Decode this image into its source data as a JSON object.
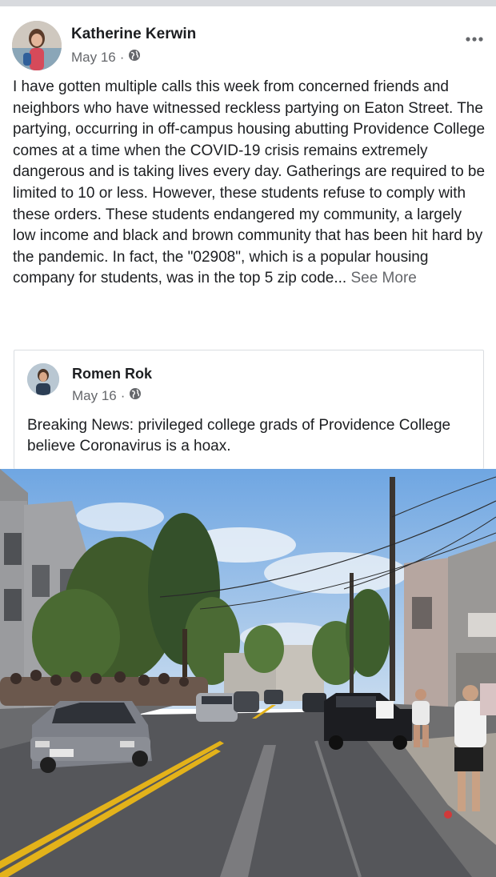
{
  "post": {
    "author": "Katherine Kerwin",
    "date": "May 16",
    "separator": "·",
    "privacy_icon": "globe-icon",
    "more_icon": "ellipsis-icon",
    "body": "I have gotten multiple calls this week from concerned friends and neighbors who have witnessed  reckless partying on Eaton Street. The partying, occurring in off-campus housing abutting Providence College comes at a time when the COVID-19 crisis remains extremely dangerous and is taking lives every day. Gatherings are required to be limited to 10 or less. However, these students refuse to comply with these orders. These students endangered my community, a largely low income and black and brown community that has been hit hard by the pandemic. In fact, the \"02908\", which is a popular housing company for students, was in the top 5 zip code...",
    "see_more": "See More"
  },
  "shared": {
    "author": "Romen Rok",
    "date": "May 16",
    "separator": "·",
    "privacy_icon": "globe-icon",
    "text": "Breaking News: privileged college grads of Providence College believe Coronavirus is a hoax."
  },
  "colors": {
    "text": "#1c1e21",
    "secondary": "#65676b",
    "border": "#dadde1",
    "sky": "#7fb3e6",
    "road": "#55565a",
    "center_line": "#e3b21a"
  }
}
